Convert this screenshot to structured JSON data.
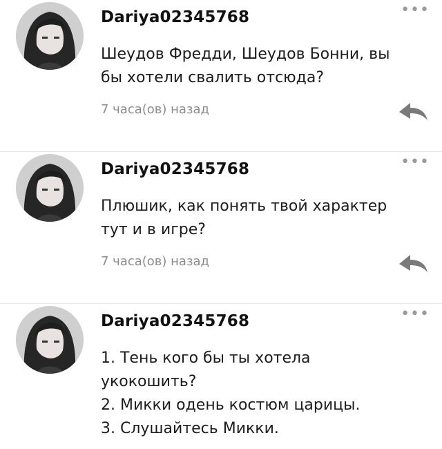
{
  "comments": [
    {
      "username": "Dariya02345768",
      "lines": [
        "Шеудов Фредди, Шеудов Бонни, вы",
        "бы хотели свалить отсюда?"
      ],
      "time": "7 часа(ов) назад"
    },
    {
      "username": "Dariya02345768",
      "lines": [
        "Плюшик, как понять твой характер",
        "тут и в игре?"
      ],
      "time": "7 часа(ов) назад"
    },
    {
      "username": "Dariya02345768",
      "lines": [
        "1. Тень кого бы ты хотела",
        "укокошить?",
        "2. Микки одень костюм царицы.",
        "3. Слушайтесь Микки."
      ]
    }
  ],
  "icons": {
    "more": "more-dots-icon",
    "reply": "reply-arrow-icon"
  },
  "more_glyph": "•••"
}
